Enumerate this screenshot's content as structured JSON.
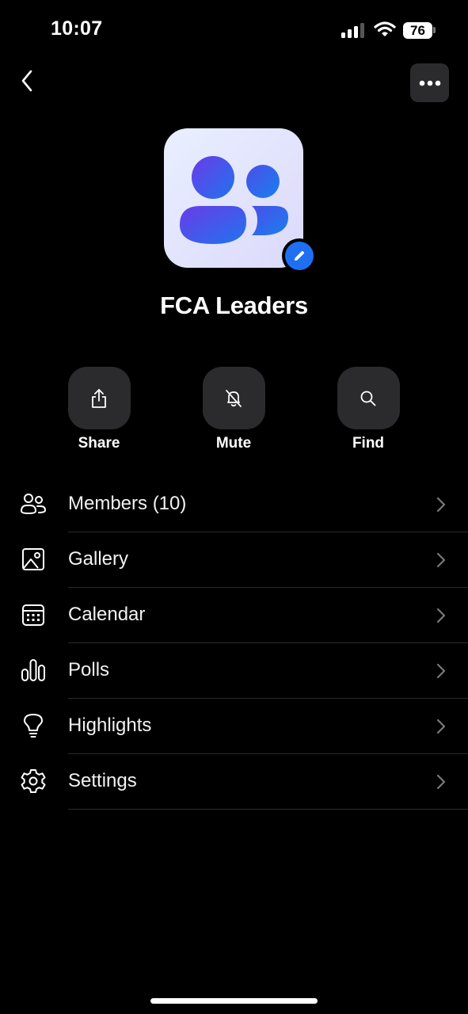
{
  "status_bar": {
    "time": "10:07",
    "battery": "76"
  },
  "header": {
    "back_icon": "chevron-left-icon",
    "more_icon": "ellipsis-icon"
  },
  "group": {
    "name": "FCA Leaders",
    "avatar_icon": "people-icon",
    "edit_icon": "pencil-icon",
    "accent_color": "#1f6ff2"
  },
  "actions": [
    {
      "label": "Share",
      "icon": "share-icon"
    },
    {
      "label": "Mute",
      "icon": "bell-slash-icon"
    },
    {
      "label": "Find",
      "icon": "search-icon"
    }
  ],
  "menu": [
    {
      "label": "Members (10)",
      "icon": "members-icon"
    },
    {
      "label": "Gallery",
      "icon": "gallery-icon"
    },
    {
      "label": "Calendar",
      "icon": "calendar-icon"
    },
    {
      "label": "Polls",
      "icon": "polls-icon"
    },
    {
      "label": "Highlights",
      "icon": "lightbulb-icon"
    },
    {
      "label": "Settings",
      "icon": "gear-icon"
    }
  ]
}
